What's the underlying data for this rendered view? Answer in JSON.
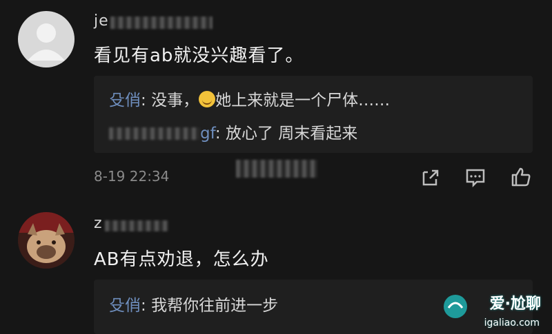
{
  "comments": [
    {
      "username_visible": "je",
      "content": "看见有ab就没兴趣看了。",
      "replies": [
        {
          "name": "殳俏",
          "sep": ": ",
          "text": "没事，",
          "emoji": "smile-emoji",
          "text2": "她上来就是一个尸体……"
        },
        {
          "name_tail": "gf",
          "sep": ": ",
          "text": "放心了  周末看起来"
        }
      ],
      "timestamp": "8-19 22:34"
    },
    {
      "username_visible": "z",
      "content": "AB有点劝退，怎么办",
      "replies": [
        {
          "name": "殳俏",
          "sep": ": ",
          "text": "我帮你往前进一步"
        }
      ]
    }
  ],
  "watermark": {
    "text": "爱·尬聊",
    "url": "igaliao.com"
  },
  "colors": {
    "background": "#161616",
    "reply_box": "#1f1f1f",
    "reply_name": "#6f8fbf",
    "meta": "#8a8a8a"
  }
}
